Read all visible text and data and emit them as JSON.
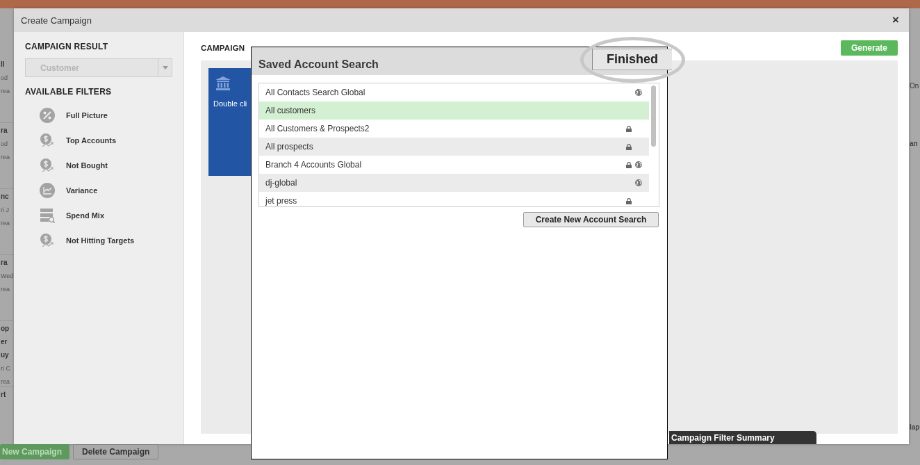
{
  "background": {
    "left_cards": [
      {
        "lines": [
          {
            "kind": "title",
            "text": "ll"
          },
          {
            "kind": "detail",
            "text": "od"
          },
          {
            "kind": "detail",
            "text": "rea"
          }
        ]
      },
      {
        "lines": [
          {
            "kind": "title",
            "text": "ra"
          },
          {
            "kind": "detail",
            "text": "od"
          },
          {
            "kind": "detail",
            "text": "rea"
          }
        ]
      },
      {
        "lines": [
          {
            "kind": "title",
            "text": "nc"
          },
          {
            "kind": "detail",
            "text": "ri J"
          },
          {
            "kind": "detail",
            "text": "rea"
          }
        ]
      },
      {
        "lines": [
          {
            "kind": "title",
            "text": "ra"
          },
          {
            "kind": "detail",
            "text": "Wed"
          },
          {
            "kind": "detail",
            "text": "rea"
          }
        ]
      },
      {
        "lines": [
          {
            "kind": "title",
            "text": "op"
          },
          {
            "kind": "title",
            "text": "er"
          },
          {
            "kind": "title",
            "text": "uy"
          },
          {
            "kind": "detail",
            "text": "ri C"
          },
          {
            "kind": "detail",
            "text": "rea"
          }
        ]
      },
      {
        "lines": [
          {
            "kind": "title",
            "text": "rt"
          }
        ]
      }
    ],
    "right_texts": [
      "On",
      "an",
      "lap"
    ],
    "buttons": [
      {
        "label": "New Campaign",
        "kind": "primary"
      },
      {
        "label": "Delete Campaign",
        "kind": "default"
      }
    ]
  },
  "modal": {
    "title": "Create Campaign",
    "close": "×",
    "campaign_result": {
      "heading": "CAMPAIGN RESULT",
      "select": {
        "value": "Customer",
        "disabled": true
      }
    },
    "filters": {
      "heading": "AVAILABLE FILTERS",
      "items": [
        {
          "label": "Full Picture",
          "kind": "percent"
        },
        {
          "label": "Top Accounts",
          "kind": "money"
        },
        {
          "label": "Not Bought",
          "kind": "money"
        },
        {
          "label": "Variance",
          "kind": "chart"
        },
        {
          "label": "Spend Mix",
          "kind": "table"
        },
        {
          "label": "Not Hitting Targets",
          "kind": "money"
        }
      ]
    },
    "section_heading": "CAMPAIGN",
    "generate_button": "Generate",
    "tile_text": "Double cli",
    "summary_tab": "Campaign Filter Summary"
  },
  "dialog": {
    "title": "Saved Account Search",
    "finished_button": "Finished",
    "highlighted": true,
    "searches": [
      {
        "name": "All Contacts Search Global",
        "selected": false,
        "private": false,
        "global": true
      },
      {
        "name": "All customers",
        "selected": true,
        "private": false,
        "global": false
      },
      {
        "name": "All Customers & Prospects2",
        "selected": false,
        "private": true,
        "global": false
      },
      {
        "name": "All prospects",
        "selected": false,
        "private": true,
        "global": false
      },
      {
        "name": "Branch 4 Accounts Global",
        "selected": false,
        "private": true,
        "global": true
      },
      {
        "name": "dj-global",
        "selected": false,
        "private": false,
        "global": true
      },
      {
        "name": "jet press",
        "selected": false,
        "private": true,
        "global": false
      }
    ],
    "create_button": "Create New Account Search"
  }
}
